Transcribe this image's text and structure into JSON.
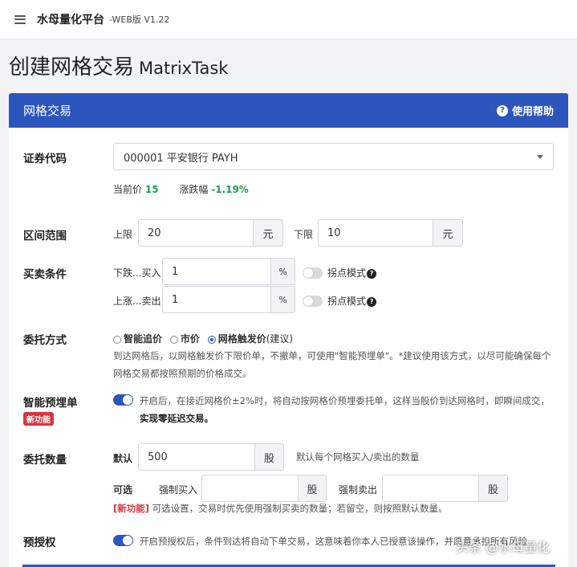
{
  "header": {
    "title": "水母量化平台",
    "version": "-WEB版 V1.22"
  },
  "page": {
    "title_zh": "创建网格交易",
    "title_en": "MatrixTask"
  },
  "card": {
    "title": "网格交易",
    "help_label": "使用帮助"
  },
  "security": {
    "label": "证券代码",
    "selected": "000001 平安银行 PAYH",
    "price_label": "当前价",
    "price": "15",
    "change_label": "涨跌幅",
    "change": "-1.19%"
  },
  "range": {
    "label": "区间范围",
    "upper_label": "上限",
    "upper_value": "20",
    "upper_unit": "元",
    "lower_label": "下限",
    "lower_value": "10",
    "lower_unit": "元"
  },
  "condition": {
    "label": "买卖条件",
    "buy_label": "下跌...买入",
    "buy_value": "1",
    "buy_unit": "%",
    "sell_label": "上涨...卖出",
    "sell_value": "1",
    "sell_unit": "%",
    "tick_mode_label": "拐点模式"
  },
  "order_type": {
    "label": "委托方式",
    "options": [
      "智能追价",
      "市价",
      "网格触发价"
    ],
    "recommended": "(建议)",
    "desc_line1": "到达网格后，以网格触发价下限价单，不撤单，可使用\"智能预埋单\"。*建议使用该方式，以尽可能确保每个",
    "desc_line2": "网格交易都按照预期的价格成交。"
  },
  "smart_order": {
    "label": "智能预埋单",
    "badge": "新功能",
    "desc_line1": "开启后，在接近网格价±2%时，将自动按网格价预埋委托单，这样当股价到达网格时，即瞬间成交，",
    "desc_line2": "实现零延迟交易。"
  },
  "quantity": {
    "label": "委托数量",
    "default_label": "默认",
    "default_value": "500",
    "unit": "股",
    "default_hint": "默认每个网格买入/卖出的数量",
    "optional_label": "可选",
    "force_buy_label": "强制买入",
    "force_sell_label": "强制卖出",
    "new_tag": "[新功能]",
    "optional_hint": "可选设置，交易时优先使用强制买卖的数量；若留空，则按照默认数量。"
  },
  "preauth": {
    "label": "预授权",
    "desc": "开启预授权后，条件到达将自动下单交易，这意味着你本人已授意该操作，并愿意承担所有风险"
  },
  "watermark": "头条 @水母量化",
  "colors": {
    "primary": "#2d55be",
    "up": "#1e9e4a",
    "danger": "#d9363e"
  }
}
